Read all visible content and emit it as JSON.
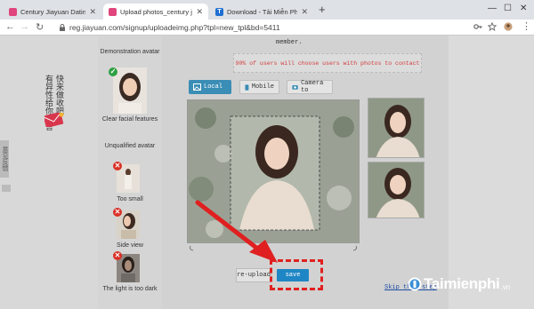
{
  "browser": {
    "tabs": [
      {
        "title": "Century Jiayuan Dating Network",
        "favicon_color": "#e0457b",
        "active": false
      },
      {
        "title": "Upload photos_century jiayuan d",
        "favicon_color": "#e0457b",
        "active": true
      },
      {
        "title": "Download - Tải Miễn Phí VN - Pho",
        "favicon_color": "#1f6fd1",
        "favicon_letter": "T",
        "active": false
      }
    ],
    "new_tab": "+",
    "url": "reg.jiayuan.com/signup/uploadeimg.php?tpl=new_tpl&bd=5411"
  },
  "sidebar": {
    "vertical_text_a": "快来做收吧",
    "vertical_text_b": "有异性给你留言",
    "side_tab": "意见反馈"
  },
  "avatar_guide": {
    "demo_label": "Demonstration avatar",
    "demo_caption": "Clear facial features",
    "unqualified_label": "Unqualified avatar",
    "items": [
      {
        "caption": "Too small"
      },
      {
        "caption": "Side view"
      },
      {
        "caption": "The light is too dark"
      }
    ]
  },
  "main": {
    "member_text": "member.",
    "notice": "90% of users will choose users with photos to contact",
    "sources": [
      {
        "label": "Local",
        "icon": "image-icon"
      },
      {
        "label": "Mobile",
        "icon": "phone-icon"
      },
      {
        "label": "Camera to",
        "icon": "camera-icon"
      }
    ],
    "reupload_label": "re-upload",
    "save_label": "save",
    "skip_label": "Skip this step"
  },
  "watermark": {
    "brand": "Taimienphi",
    "suffix": ".vn"
  },
  "colors": {
    "accent": "#1f86c5",
    "highlight": "#e02020",
    "notice_text": "#d23a3a"
  }
}
